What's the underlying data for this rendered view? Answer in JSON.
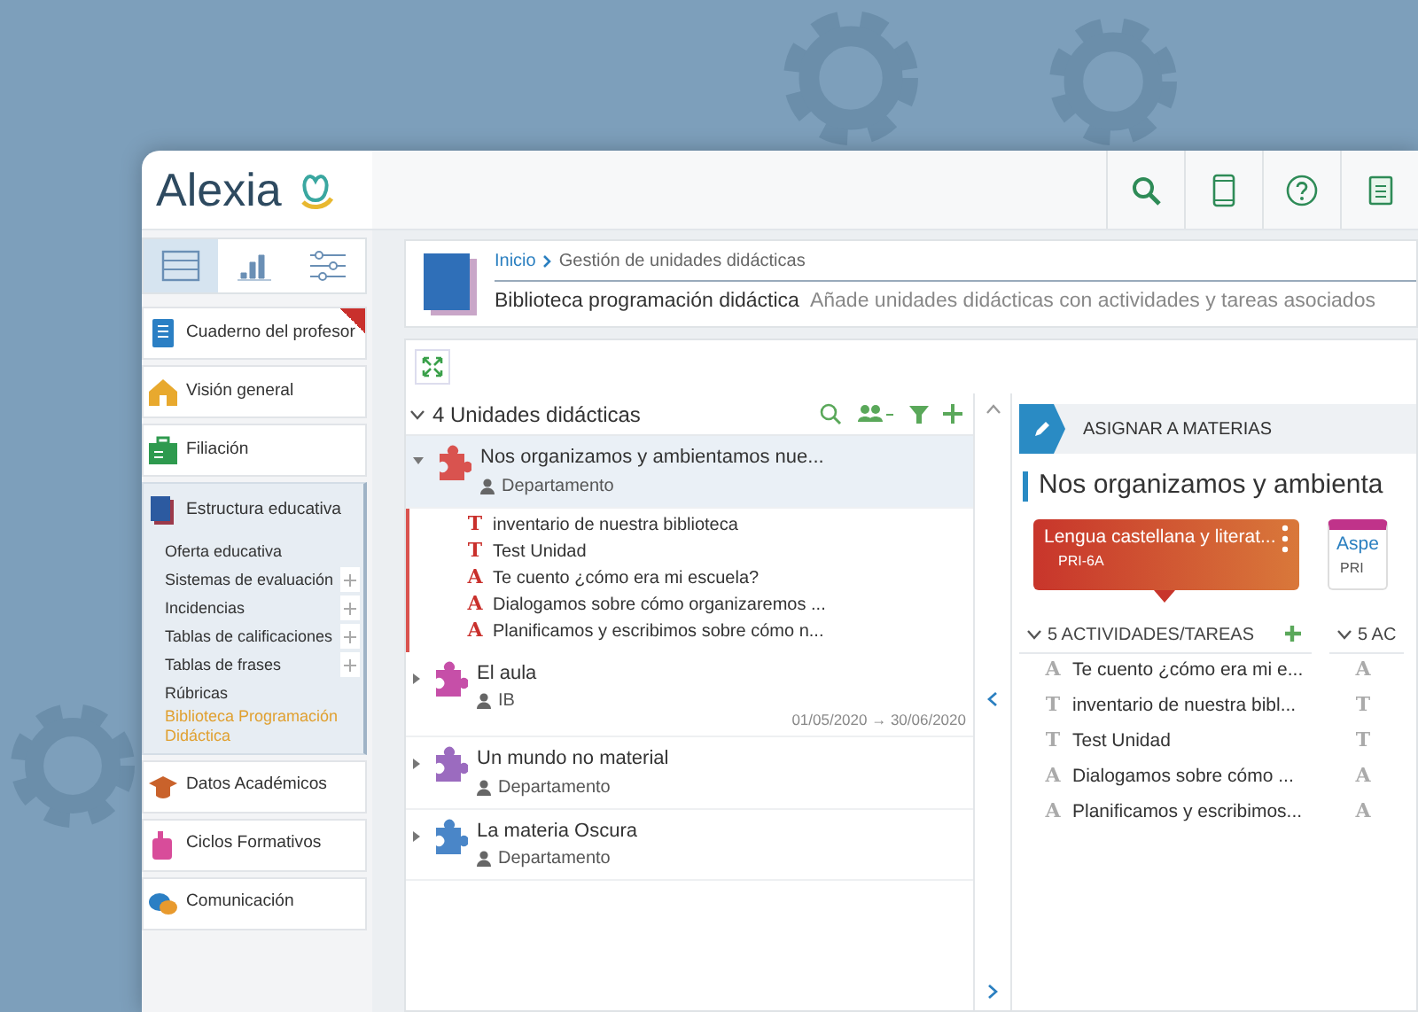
{
  "logo": {
    "text": "Alexia"
  },
  "view_switcher": [
    {
      "selected": true
    },
    {
      "selected": false
    },
    {
      "selected": false
    }
  ],
  "sidebar": {
    "items": [
      {
        "label": "Cuaderno del profesor",
        "flagged": true,
        "expanded": false
      },
      {
        "label": "Visión general",
        "flagged": false,
        "expanded": false
      },
      {
        "label": "Filiación",
        "flagged": false,
        "expanded": false
      },
      {
        "label": "Estructura educativa",
        "flagged": false,
        "expanded": true,
        "children": [
          {
            "label": "Oferta educativa",
            "expandable": false,
            "selected": false
          },
          {
            "label": "Sistemas de evaluación",
            "expandable": true,
            "selected": false
          },
          {
            "label": "Incidencias",
            "expandable": true,
            "selected": false
          },
          {
            "label": "Tablas de calificaciones",
            "expandable": true,
            "selected": false
          },
          {
            "label": "Tablas de frases",
            "expandable": true,
            "selected": false
          },
          {
            "label": "Rúbricas",
            "expandable": false,
            "selected": false
          },
          {
            "label": "Biblioteca Programación Didáctica",
            "expandable": false,
            "selected": true
          }
        ]
      },
      {
        "label": "Datos Académicos",
        "flagged": false,
        "expanded": false
      },
      {
        "label": "Ciclos Formativos",
        "flagged": false,
        "expanded": false
      },
      {
        "label": "Comunicación",
        "flagged": false,
        "expanded": false
      }
    ]
  },
  "breadcrumb": [
    "Inicio",
    "Gestión de unidades didácticas"
  ],
  "page_title": "Biblioteca programación didáctica",
  "page_subtitle": "Añade unidades didácticas con actividades y tareas asociados",
  "units_panel": {
    "heading": "4 Unidades didácticas",
    "expanded": true,
    "units": [
      {
        "title": "Nos organizamos y ambientamos nue...",
        "owner": "Departamento",
        "color": "#d9534f",
        "expanded": true,
        "selected": true,
        "children": [
          {
            "marker": "T",
            "title": "inventario de nuestra biblioteca"
          },
          {
            "marker": "T",
            "title": "Test Unidad"
          },
          {
            "marker": "A",
            "title": "Te cuento ¿cómo era mi escuela?"
          },
          {
            "marker": "A",
            "title": "Dialogamos sobre cómo organizaremos ..."
          },
          {
            "marker": "A",
            "title": "Planificamos y escribimos sobre cómo n..."
          }
        ]
      },
      {
        "title": "El aula",
        "owner": "IB",
        "color": "#c64fa8",
        "expanded": false,
        "selected": false,
        "date_range": "01/05/2020 → 30/06/2020"
      },
      {
        "title": "Un mundo no material",
        "owner": "Departamento",
        "color": "#9b6bbf",
        "expanded": false,
        "selected": false
      },
      {
        "title": "La materia Oscura",
        "owner": "Departamento",
        "color": "#4a86c8",
        "expanded": false,
        "selected": false
      }
    ]
  },
  "assign_panel": {
    "action": "ASIGNAR A MATERIAS",
    "title": "Nos organizamos y ambienta",
    "subjects": [
      {
        "name": "Lengua castellana y literat...",
        "code": "PRI-6A",
        "color": "#c8352b",
        "selected": true
      },
      {
        "name": "Aspe",
        "code": "PRI",
        "color": "#c0338a",
        "selected": false
      }
    ],
    "columns": [
      {
        "heading": "5 ACTIVIDADES/TAREAS",
        "items": [
          {
            "marker": "A",
            "title": "Te cuento ¿cómo era mi e..."
          },
          {
            "marker": "T",
            "title": "inventario de nuestra bibl..."
          },
          {
            "marker": "T",
            "title": "Test Unidad"
          },
          {
            "marker": "A",
            "title": "Dialogamos sobre cómo ..."
          },
          {
            "marker": "A",
            "title": "Planificamos y escribimos..."
          }
        ]
      },
      {
        "heading": "5 AC",
        "items": [
          {
            "marker": "A"
          },
          {
            "marker": "T"
          },
          {
            "marker": "T"
          },
          {
            "marker": "A"
          },
          {
            "marker": "A"
          }
        ]
      }
    ]
  }
}
